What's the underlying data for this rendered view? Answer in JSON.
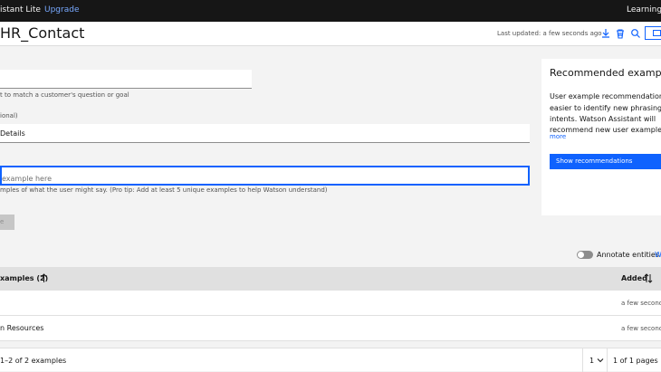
{
  "topbar": {
    "brand": "istant Lite",
    "upgrade": "Upgrade",
    "learning": "Learning c"
  },
  "header": {
    "title": "HR_Contact",
    "last_updated": "Last updated: a few seconds ago",
    "icons": [
      "download-icon",
      "trash-icon",
      "search-icon",
      "chat-icon"
    ]
  },
  "form": {
    "name_helper": "t to match a customer's question or goal",
    "description_label": "ional)",
    "description_value": "Details",
    "example_placeholder": "example here",
    "example_helper": "mples of what the user might say. (Pro tip: Add at least 5 unique examples to help Watson understand)",
    "add_button": "e"
  },
  "recommended": {
    "title": "Recommended examples",
    "lines": [
      "User example recommendations",
      "easier to identify new phrasing",
      "intents. Watson Assistant will",
      "recommend new user examples"
    ],
    "more": "more",
    "button": "Show recommendations"
  },
  "annotate": {
    "label": "Annotate entities",
    "link": "W",
    "enabled": false
  },
  "table": {
    "header_examples": "xamples (2)",
    "header_added": "Added",
    "rows": [
      {
        "example": "",
        "added": "a few second"
      },
      {
        "example": "n Resources",
        "added": "a few second"
      }
    ]
  },
  "pagination": {
    "count": "1–2 of 2 examples",
    "page": "1",
    "of_pages": "1 of 1 pages"
  },
  "colors": {
    "topbar": "#161616",
    "accent": "#0f62fe",
    "background": "#f3f3f3"
  }
}
